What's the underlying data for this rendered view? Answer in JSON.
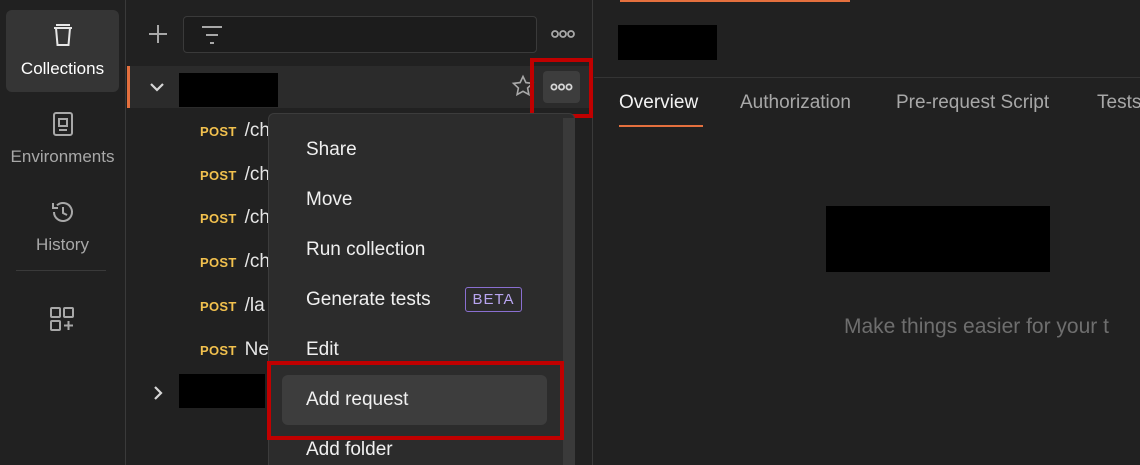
{
  "sidebar": {
    "items": [
      {
        "label": "Collections",
        "icon": "trash-bin-icon"
      },
      {
        "label": "Environments",
        "icon": "environment-icon"
      },
      {
        "label": "History",
        "icon": "history-icon"
      }
    ],
    "apps_icon": "apps-add-icon"
  },
  "collection": {
    "requests": [
      {
        "method": "POST",
        "path": "/ch"
      },
      {
        "method": "POST",
        "path": "/ch"
      },
      {
        "method": "POST",
        "path": "/ch"
      },
      {
        "method": "POST",
        "path": "/ch"
      },
      {
        "method": "POST",
        "path": "/la"
      },
      {
        "method": "POST",
        "path": "Ne"
      }
    ]
  },
  "menu": {
    "items": [
      "Share",
      "Move",
      "Run collection",
      "Generate tests",
      "Edit",
      "Add request",
      "Add folder"
    ],
    "beta_badge": "BETA"
  },
  "right_pane": {
    "tabs": [
      "Overview",
      "Authorization",
      "Pre-request Script",
      "Tests"
    ],
    "tagline": "Make things easier for your t"
  },
  "colors": {
    "accent": "#e4703e",
    "highlight": "#c00000",
    "method_post": "#f2c14e",
    "beta": "#b8a5f0"
  }
}
